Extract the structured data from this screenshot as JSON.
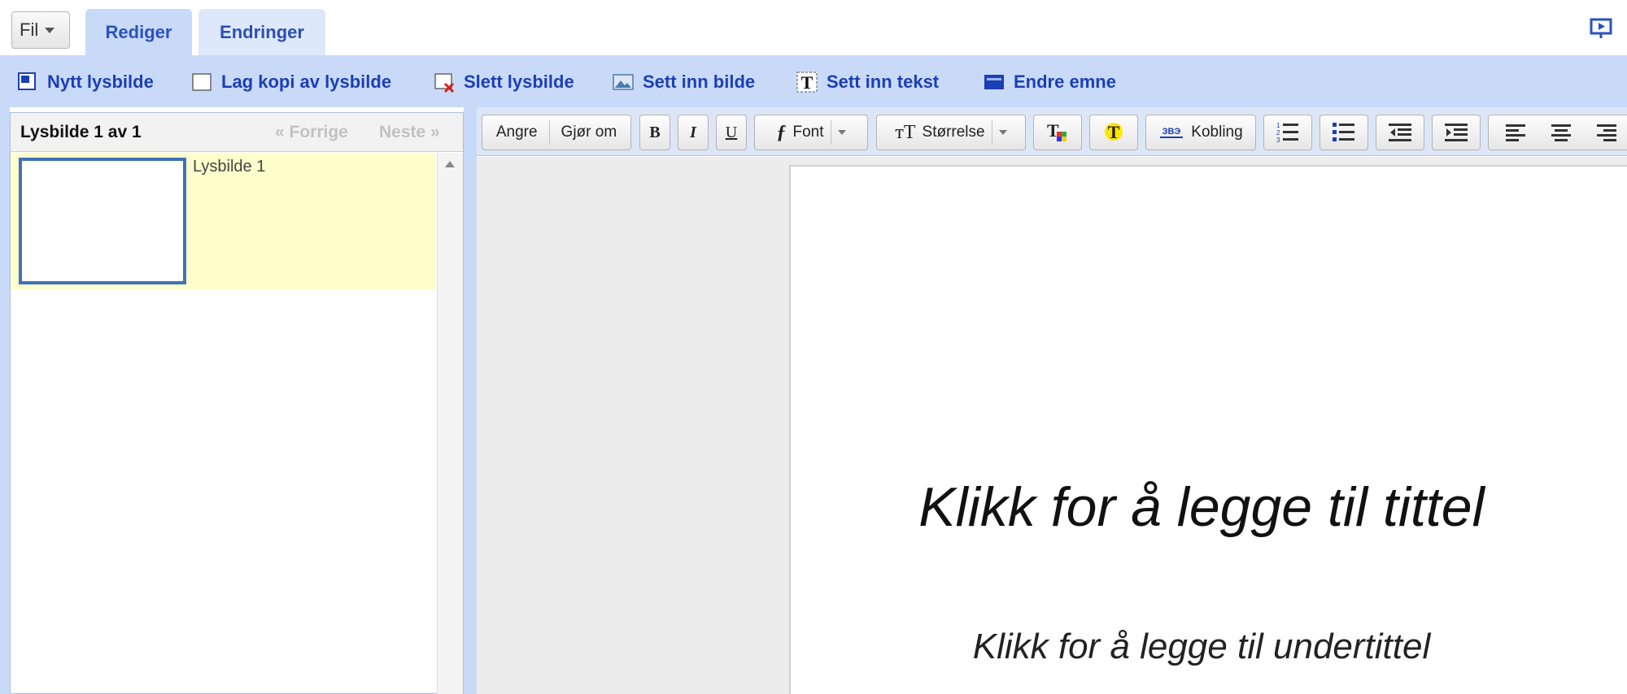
{
  "topbar": {
    "file_menu": "Fil",
    "tabs": [
      {
        "label": "Rediger",
        "active": true
      },
      {
        "label": "Endringer",
        "active": false
      }
    ]
  },
  "actions": [
    {
      "label": "Nytt lysbilde",
      "icon": "new-slide-icon"
    },
    {
      "label": "Lag kopi av lysbilde",
      "icon": "copy-slide-icon"
    },
    {
      "label": "Slett lysbilde",
      "icon": "delete-slide-icon"
    },
    {
      "label": "Sett inn bilde",
      "icon": "image-icon"
    },
    {
      "label": "Sett inn tekst",
      "icon": "text-box-icon"
    },
    {
      "label": "Endre emne",
      "icon": "theme-icon"
    }
  ],
  "slides_panel": {
    "count_label": "Lysbilde 1 av 1",
    "prev_label": "« Forrige",
    "next_label": "Neste »",
    "slides": [
      {
        "label": "Lysbilde 1"
      }
    ]
  },
  "format_toolbar": {
    "undo": "Angre",
    "redo": "Gjør om",
    "bold": "B",
    "italic": "I",
    "underline": "U",
    "font": "Font",
    "size": "Størrelse",
    "link": "Kobling"
  },
  "slide": {
    "title_placeholder": "Klikk for å legge til tittel",
    "subtitle_placeholder": "Klikk for å legge til undertittel"
  },
  "colors": {
    "toolbar_blue": "#c9daf8",
    "link_blue": "#1c3fb5",
    "selected_row": "#ffffcc"
  }
}
